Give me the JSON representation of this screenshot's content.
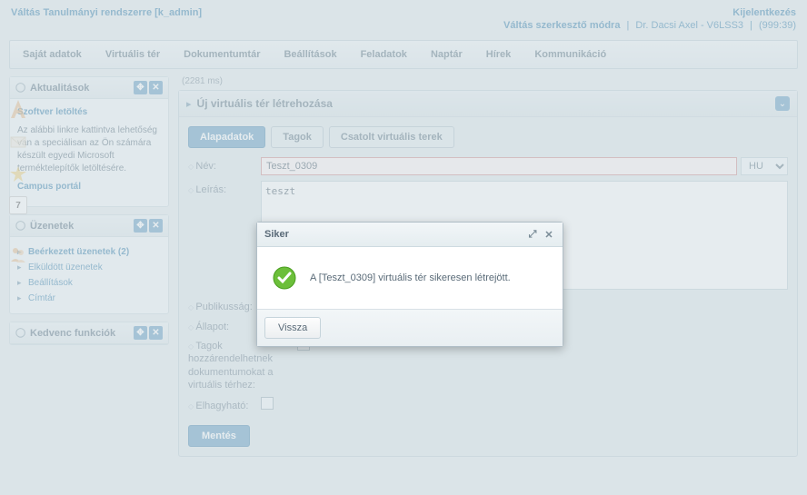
{
  "header": {
    "switch_system": "Váltás Tanulmányi rendszerre  [k_admin]",
    "logout": "Kijelentkezés",
    "switch_edit": "Váltás szerkesztő módra",
    "user": "Dr. Dacsi Axel - V6LSS3",
    "time": "(999:39)"
  },
  "menu": {
    "items": [
      "Saját adatok",
      "Virtuális tér",
      "Dokumentumtár",
      "Beállítások",
      "Feladatok",
      "Naptár",
      "Hírek",
      "Kommunikáció"
    ]
  },
  "sidebar": {
    "news": {
      "title": "Aktualitások",
      "link1": "Szoftver letöltés",
      "text": "Az alábbi linkre kattintva lehetőség van a speciálisan az Ön számára készült egyedi Microsoft terméktelepítők letöltésére.",
      "link2": "Campus portál"
    },
    "messages": {
      "title": "Üzenetek",
      "items": [
        "Beérkezett üzenetek (2)",
        "Elküldött üzenetek",
        "Beállítások",
        "Címtár"
      ]
    },
    "fav": {
      "title": "Kedvenc funkciók"
    },
    "cal_day": "7"
  },
  "main": {
    "timing": "(2281 ms)",
    "panel_title": "Új virtuális tér létrehozása",
    "tabs": [
      "Alapadatok",
      "Tagok",
      "Csatolt virtuális terek"
    ],
    "form": {
      "name_label": "Név:",
      "name_value": "Teszt_0309",
      "lang": "HU",
      "desc_label": "Leírás:",
      "desc_value": "teszt",
      "public_label": "Publikusság:",
      "state_label": "Állapot:",
      "members_label": "Tagok hozzárendelhetnek dokumentumokat a virtuális térhez:",
      "omit_label": "Elhagyható:"
    },
    "save": "Mentés"
  },
  "dialog": {
    "title": "Siker",
    "message": "A [Teszt_0309] virtuális tér sikeresen létrejött.",
    "back": "Vissza"
  }
}
